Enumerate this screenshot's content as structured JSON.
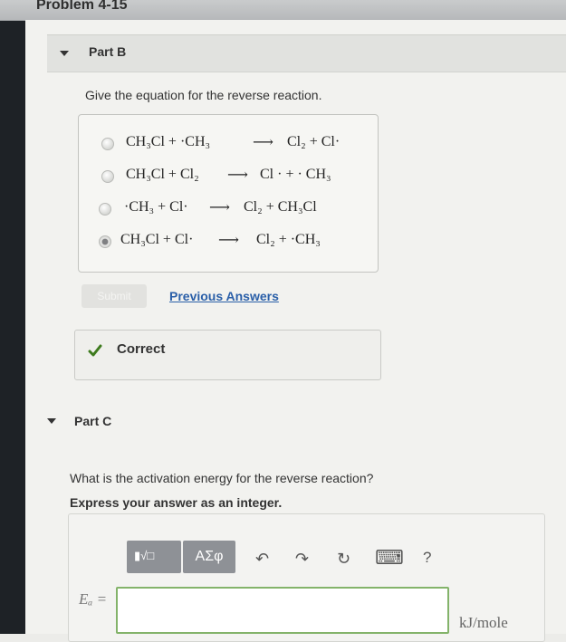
{
  "problem": {
    "title": "Problem 4-15"
  },
  "part_b": {
    "label": "Part B",
    "question": "Give the equation for the reverse reaction.",
    "choices": [
      {
        "left_a": "CH₃Cl + ·CH₃",
        "arrow": "⟶",
        "right_a": "Cl₂ + Cl·",
        "selected": false
      },
      {
        "left_a": "CH₃Cl + Cl₂",
        "arrow": "⟶",
        "right_a": "Cl · + · CH₃",
        "selected": false
      },
      {
        "left_a": "·CH₃ + Cl·",
        "arrow": "⟶",
        "right_a": "Cl₂ + CH₃Cl",
        "selected": false
      },
      {
        "left_a": "CH₃Cl + Cl·",
        "arrow": "⟶",
        "right_a": "Cl₂ + ·CH₃",
        "selected": true
      }
    ],
    "submit_label": "Submit",
    "previous_answers_label": "Previous Answers",
    "feedback": "Correct"
  },
  "part_c": {
    "label": "Part C",
    "question": "What is the activation energy for the reverse reaction?",
    "instruction": "Express your answer as an integer.",
    "toolbar": {
      "templates_label": "▮√□",
      "greek_label": "ΑΣφ",
      "undo_icon": "↶",
      "redo_icon": "↷",
      "reset_icon": "↻",
      "keyboard_icon": "⌨",
      "help_label": "?"
    },
    "answer_label": "Eₐ =",
    "answer_value": "",
    "units": "kJ/mole"
  },
  "colors": {
    "accent_link": "#2a5fa8",
    "check_green": "#3e7b1e",
    "input_border": "#83b36a"
  }
}
